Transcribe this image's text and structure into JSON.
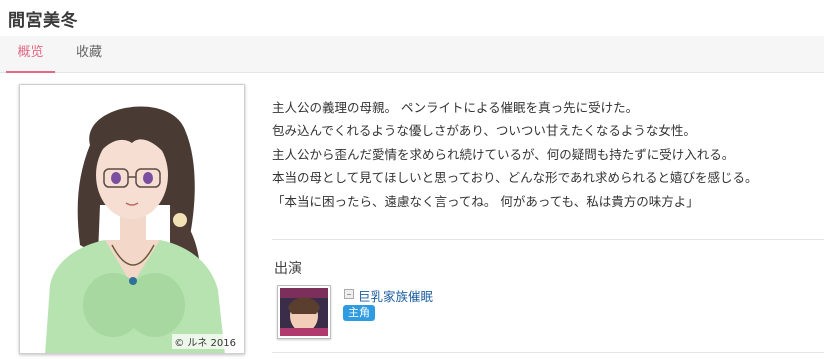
{
  "header": {
    "title": "間宮美冬"
  },
  "tabs": [
    {
      "label": "概览",
      "active": true
    },
    {
      "label": "收藏",
      "active": false
    }
  ],
  "portrait": {
    "copyright": "© ルネ 2016"
  },
  "description": [
    "主人公の義理の母親。 ペンライトによる催眠を真っ先に受けた。",
    "包み込んでくれるような優しさがあり、ついつい甘えたくなるような女性。",
    "主人公から歪んだ愛情を求められ続けているが、何の疑問も持たずに受け入れる。",
    "本当の母として見てほしいと思っており、どんな形であれ求められると嬉びを感じる。",
    "「本当に困ったら、遠慮なく言ってね。 何があっても、私は貴方の味方よ」"
  ],
  "appearances": {
    "heading": "出演",
    "works": [
      {
        "title": "巨乳家族催眠",
        "role": "主角"
      }
    ]
  },
  "colors": {
    "accent": "#e36a85",
    "link": "#1e5fa0",
    "badge": "#2f9be0"
  }
}
